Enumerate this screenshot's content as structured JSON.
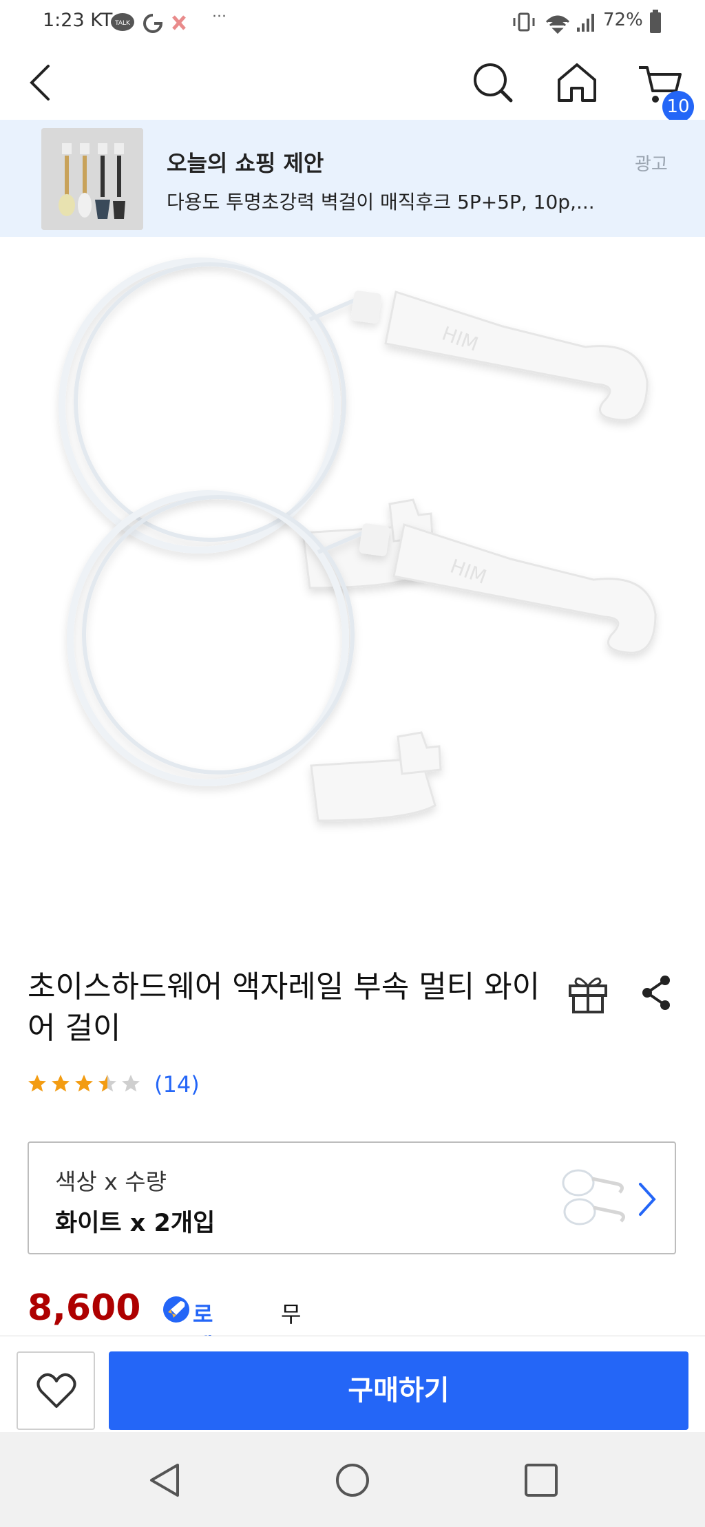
{
  "status_bar": {
    "time": "1:23",
    "carrier": "KT",
    "talk_badge": "TALK",
    "dots": "···",
    "battery": "72%"
  },
  "header": {
    "cart_count": "10"
  },
  "ad": {
    "title": "오늘의 쇼핑 제안",
    "subtitle": "다용도 투명초강력 벽걸이 매직후크 5P+5P, 10p,...",
    "tag": "광고"
  },
  "product": {
    "title": "초이스하드웨어 액자레일 부속 멀티 와이어 걸이",
    "rating": 3.5,
    "review_count": "(14)",
    "image_text": "HIM",
    "option_label": "색상 x 수량",
    "option_value": "화이트 x 2개입",
    "price": "8,600원",
    "rocket_label": "로켓와우",
    "delivery": "무료 새벽배송"
  },
  "bottom": {
    "buy_label": "구매하기"
  },
  "colors": {
    "accent": "#2466f7",
    "price": "#ae0000",
    "star": "#f39c12",
    "banner_bg": "#e9f2fd"
  },
  "icons": [
    "back-arrow-icon",
    "search-icon",
    "home-icon",
    "cart-icon",
    "gift-icon",
    "share-icon",
    "star-icon",
    "chevron-right-icon",
    "heart-icon",
    "rocket-icon",
    "nav-back-icon",
    "nav-home-icon",
    "nav-recents-icon"
  ]
}
